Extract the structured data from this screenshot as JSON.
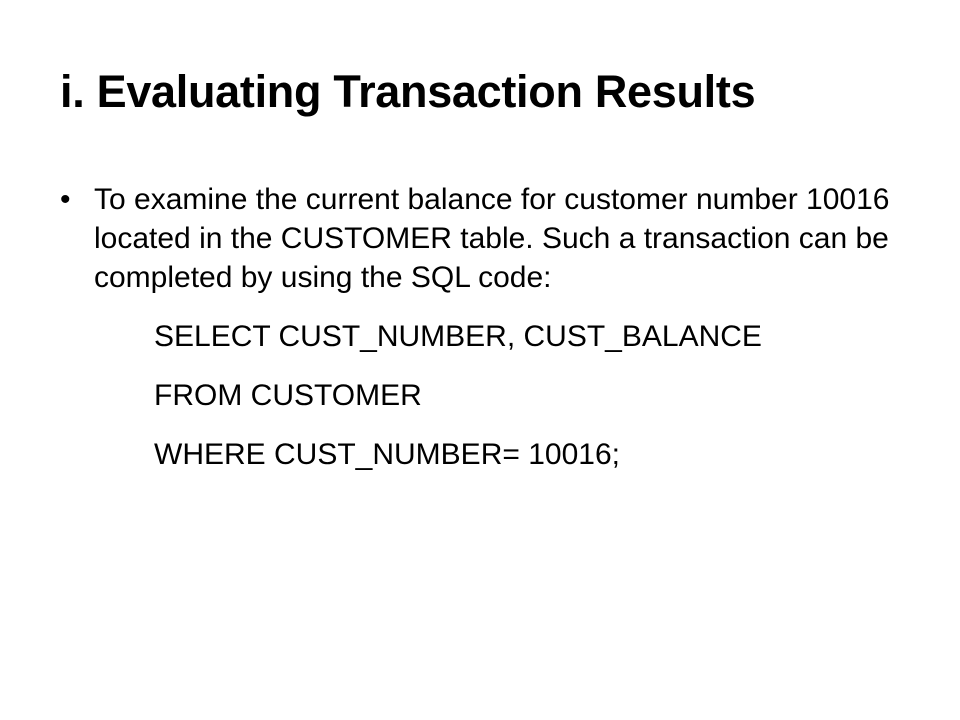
{
  "slide": {
    "title": "i. Evaluating Transaction Results",
    "bullet": {
      "marker": "•",
      "text": "To examine the current balance for customer number 10016 located in the CUSTOMER table. Such a transaction can be completed by using the SQL code:"
    },
    "code_lines": [
      "SELECT CUST_NUMBER, CUST_BALANCE",
      "FROM CUSTOMER",
      "WHERE CUST_NUMBER= 10016;"
    ]
  }
}
